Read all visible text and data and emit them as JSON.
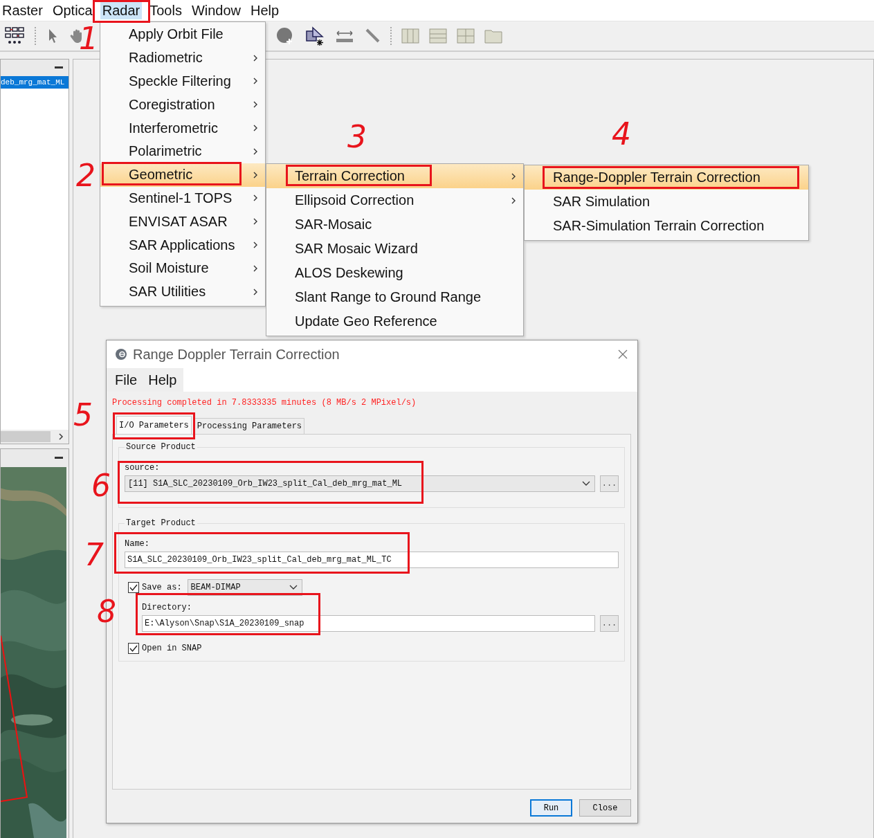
{
  "menu_bar": [
    {
      "label": "Raster",
      "selected": false
    },
    {
      "label": "Optica",
      "selected": false
    },
    {
      "label": "Radar",
      "selected": true
    },
    {
      "label": "Tools",
      "selected": false
    },
    {
      "label": "Window",
      "selected": false
    },
    {
      "label": "Help",
      "selected": false
    }
  ],
  "radar_menu": [
    {
      "label": "Apply Orbit File",
      "submenu": false,
      "selected": false
    },
    {
      "label": "Radiometric",
      "submenu": true,
      "selected": false
    },
    {
      "label": "Speckle Filtering",
      "submenu": true,
      "selected": false
    },
    {
      "label": "Coregistration",
      "submenu": true,
      "selected": false
    },
    {
      "label": "Interferometric",
      "submenu": true,
      "selected": false
    },
    {
      "label": "Polarimetric",
      "submenu": true,
      "selected": false
    },
    {
      "label": "Geometric",
      "submenu": true,
      "selected": true
    },
    {
      "label": "Sentinel-1 TOPS",
      "submenu": true,
      "selected": false
    },
    {
      "label": "ENVISAT ASAR",
      "submenu": true,
      "selected": false
    },
    {
      "label": "SAR Applications",
      "submenu": true,
      "selected": false
    },
    {
      "label": "Soil Moisture",
      "submenu": true,
      "selected": false
    },
    {
      "label": "SAR Utilities",
      "submenu": true,
      "selected": false
    }
  ],
  "geometric_menu": [
    {
      "label": "Terrain Correction",
      "submenu": true,
      "selected": true
    },
    {
      "label": "Ellipsoid Correction",
      "submenu": true,
      "selected": false
    },
    {
      "label": "SAR-Mosaic",
      "submenu": false,
      "selected": false
    },
    {
      "label": "SAR Mosaic Wizard",
      "submenu": false,
      "selected": false
    },
    {
      "label": "ALOS Deskewing",
      "submenu": false,
      "selected": false
    },
    {
      "label": "Slant Range to Ground Range",
      "submenu": false,
      "selected": false
    },
    {
      "label": "Update Geo Reference",
      "submenu": false,
      "selected": false
    }
  ],
  "terrain_menu": [
    {
      "label": "Range-Doppler Terrain Correction",
      "submenu": false,
      "selected": true
    },
    {
      "label": "SAR Simulation",
      "submenu": false,
      "selected": false
    },
    {
      "label": "SAR-Simulation Terrain Correction",
      "submenu": false,
      "selected": false
    }
  ],
  "left_panel": {
    "product_item": "deb_mrg_mat_ML"
  },
  "dialog": {
    "title": "Range Doppler Terrain Correction",
    "menu": [
      "File",
      "Help"
    ],
    "status": "Processing completed in 7.8333335 minutes (8 MB/s 2 MPixel/s)",
    "tabs": [
      {
        "label": "I/O Parameters",
        "selected": true
      },
      {
        "label": "Processing Parameters",
        "selected": false
      }
    ],
    "source_group": {
      "title": "Source Product",
      "label": "source:",
      "value": "[11] S1A_SLC_20230109_Orb_IW23_split_Cal_deb_mrg_mat_ML",
      "browse_button": "..."
    },
    "target_group": {
      "title": "Target Product",
      "name_label": "Name:",
      "name_value": "S1A_SLC_20230109_Orb_IW23_split_Cal_deb_mrg_mat_ML_TC",
      "save_as": {
        "label": "Save as:",
        "checked": true,
        "format": "BEAM-DIMAP"
      },
      "directory_label": "Directory:",
      "directory_value": "E:\\Alyson\\Snap\\S1A_20230109_snap",
      "browse_button": "...",
      "open_in_snap": {
        "label": "Open in SNAP",
        "checked": true
      }
    },
    "buttons": [
      {
        "label": "Run",
        "kind": "primary"
      },
      {
        "label": "Close",
        "kind": "normal"
      }
    ]
  },
  "annotations": [
    {
      "label": "1"
    },
    {
      "label": "2"
    },
    {
      "label": "3"
    },
    {
      "label": "4"
    },
    {
      "label": "5"
    },
    {
      "label": "6"
    },
    {
      "label": "7"
    },
    {
      "label": "8"
    }
  ]
}
